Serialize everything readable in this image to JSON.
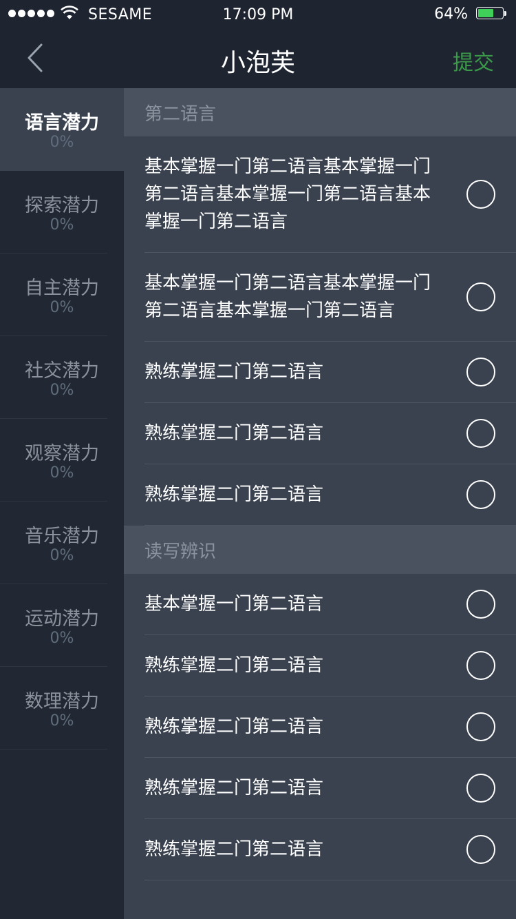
{
  "status_bar": {
    "carrier": "SESAME",
    "time": "17:09 PM",
    "battery_percent": "64%",
    "battery_level": 0.64,
    "battery_color": "#3fd05a"
  },
  "nav": {
    "title": "小泡芙",
    "submit_label": "提交",
    "back_icon": "chevron-left-icon",
    "submit_color": "#3b9a4a"
  },
  "sidebar": {
    "items": [
      {
        "name": "语言潜力",
        "percent": "0%",
        "active": true
      },
      {
        "name": "探索潜力",
        "percent": "0%"
      },
      {
        "name": "自主潜力",
        "percent": "0%"
      },
      {
        "name": "社交潜力",
        "percent": "0%"
      },
      {
        "name": "观察潜力",
        "percent": "0%"
      },
      {
        "name": "音乐潜力",
        "percent": "0%"
      },
      {
        "name": "运动潜力",
        "percent": "0%"
      },
      {
        "name": "数理潜力",
        "percent": "0%"
      }
    ]
  },
  "sections": [
    {
      "title": "第二语言",
      "options": [
        "基本掌握一门第二语言基本掌握一门第二语言基本掌握一门第二语言基本掌握一门第二语言",
        "基本掌握一门第二语言基本掌握一门第二语言基本掌握一门第二语言",
        "熟练掌握二门第二语言",
        "熟练掌握二门第二语言",
        "熟练掌握二门第二语言"
      ]
    },
    {
      "title": "读写辨识",
      "options": [
        "基本掌握一门第二语言",
        "熟练掌握二门第二语言",
        "熟练掌握二门第二语言",
        "熟练掌握二门第二语言",
        "熟练掌握二门第二语言"
      ]
    }
  ]
}
